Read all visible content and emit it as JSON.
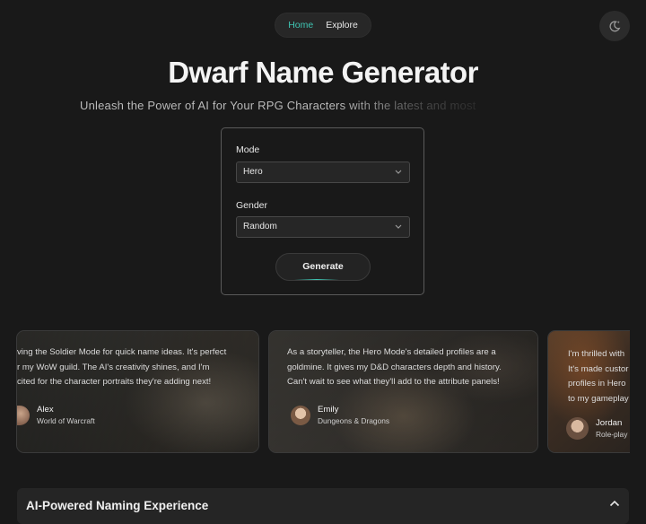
{
  "nav": {
    "home_label": "Home",
    "explore_label": "Explore",
    "active": "Home",
    "accent_color": "#3fc5b3"
  },
  "theme_toggle": {
    "icon": "moon-sparkle-icon"
  },
  "hero": {
    "title": "Dwarf Name Generator",
    "subtitle": "Unleash the Power of AI for Your RPG Characters with the latest and most"
  },
  "form": {
    "mode_label": "Mode",
    "mode_value": "Hero",
    "gender_label": "Gender",
    "gender_value": "Random",
    "generate_label": "Generate"
  },
  "testimonials": [
    {
      "quote": "ving the Soldier Mode for quick name ideas. It's perfect\nr my WoW guild. The AI's creativity shines, and I'm\ncited for the character portraits they're adding next!",
      "name": "Alex",
      "game": "World of Warcraft"
    },
    {
      "quote": "As a storyteller, the Hero Mode's detailed profiles are a\ngoldmine. It gives my D&D characters depth and history.\nCan't wait to see what they'll add to the attribute panels!",
      "name": "Emily",
      "game": "Dungeons & Dragons"
    },
    {
      "quote": "I'm thrilled with\nIt's made custor\nprofiles in Hero\nto my gameplay",
      "name": "Jordan",
      "game": "Role-play"
    }
  ],
  "faq": {
    "title": "AI-Powered Naming Experience",
    "expanded": true
  }
}
